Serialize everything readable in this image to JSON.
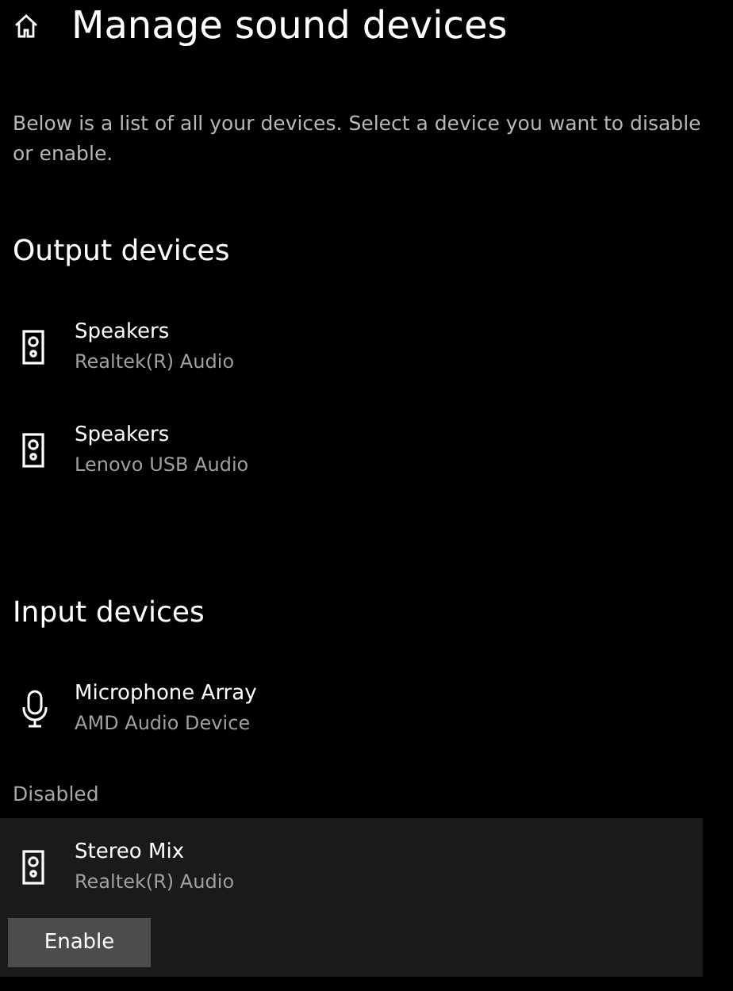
{
  "header": {
    "title": "Manage sound devices"
  },
  "description": "Below is a list of all your devices. Select a device you want to disable or enable.",
  "sections": [
    {
      "heading": "Output devices",
      "devices": [
        {
          "kind": "speaker",
          "name": "Speakers",
          "driver": "Realtek(R) Audio",
          "selected": false
        },
        {
          "kind": "speaker",
          "name": "Speakers",
          "driver": "Lenovo USB Audio",
          "selected": false
        }
      ]
    },
    {
      "heading": "Input devices",
      "devices": [
        {
          "kind": "microphone",
          "name": "Microphone Array",
          "driver": "AMD Audio Device",
          "selected": false
        }
      ]
    }
  ],
  "disabled": {
    "label": "Disabled",
    "devices": [
      {
        "kind": "speaker",
        "name": "Stereo Mix",
        "driver": "Realtek(R) Audio",
        "selected": true,
        "action": "Enable"
      }
    ]
  }
}
